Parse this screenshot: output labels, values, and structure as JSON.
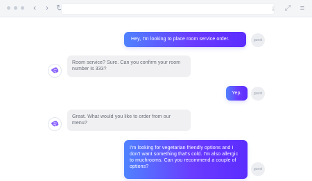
{
  "browser": {
    "traffic_lights": [
      "dot-1",
      "dot-2",
      "dot-3"
    ],
    "nav": {
      "back_symbol": "‹",
      "forward_symbol": "›",
      "reload_symbol": "↻"
    },
    "right_icons": {
      "download_symbol": "↓",
      "expand_symbol": "⤢",
      "menu_symbol": "≡"
    }
  },
  "chat": {
    "messages": [
      {
        "sender": "user",
        "text": "Hey, I'm looking to place room service order.",
        "badge": "guest"
      },
      {
        "sender": "bot",
        "text": "Room service? Sure. Can you confirm your room number is 333?"
      },
      {
        "sender": "user",
        "text": "Yep.",
        "badge": "guest"
      },
      {
        "sender": "bot",
        "text": "Great. What would you like to order from our menu?"
      },
      {
        "sender": "user",
        "text": "I'm looking for vegetarian friendly options and I don't want something that's cold. I'm also allergic to muchrooms. Can you recommend a couple of options?",
        "badge": "guest"
      }
    ]
  },
  "colors": {
    "user_gradient_start": "#4f82ff",
    "user_gradient_end": "#5b2cff",
    "bot_bubble": "#f0f0f2",
    "bot_text": "#666b75",
    "toolbar_bg": "#f4f5f7"
  }
}
